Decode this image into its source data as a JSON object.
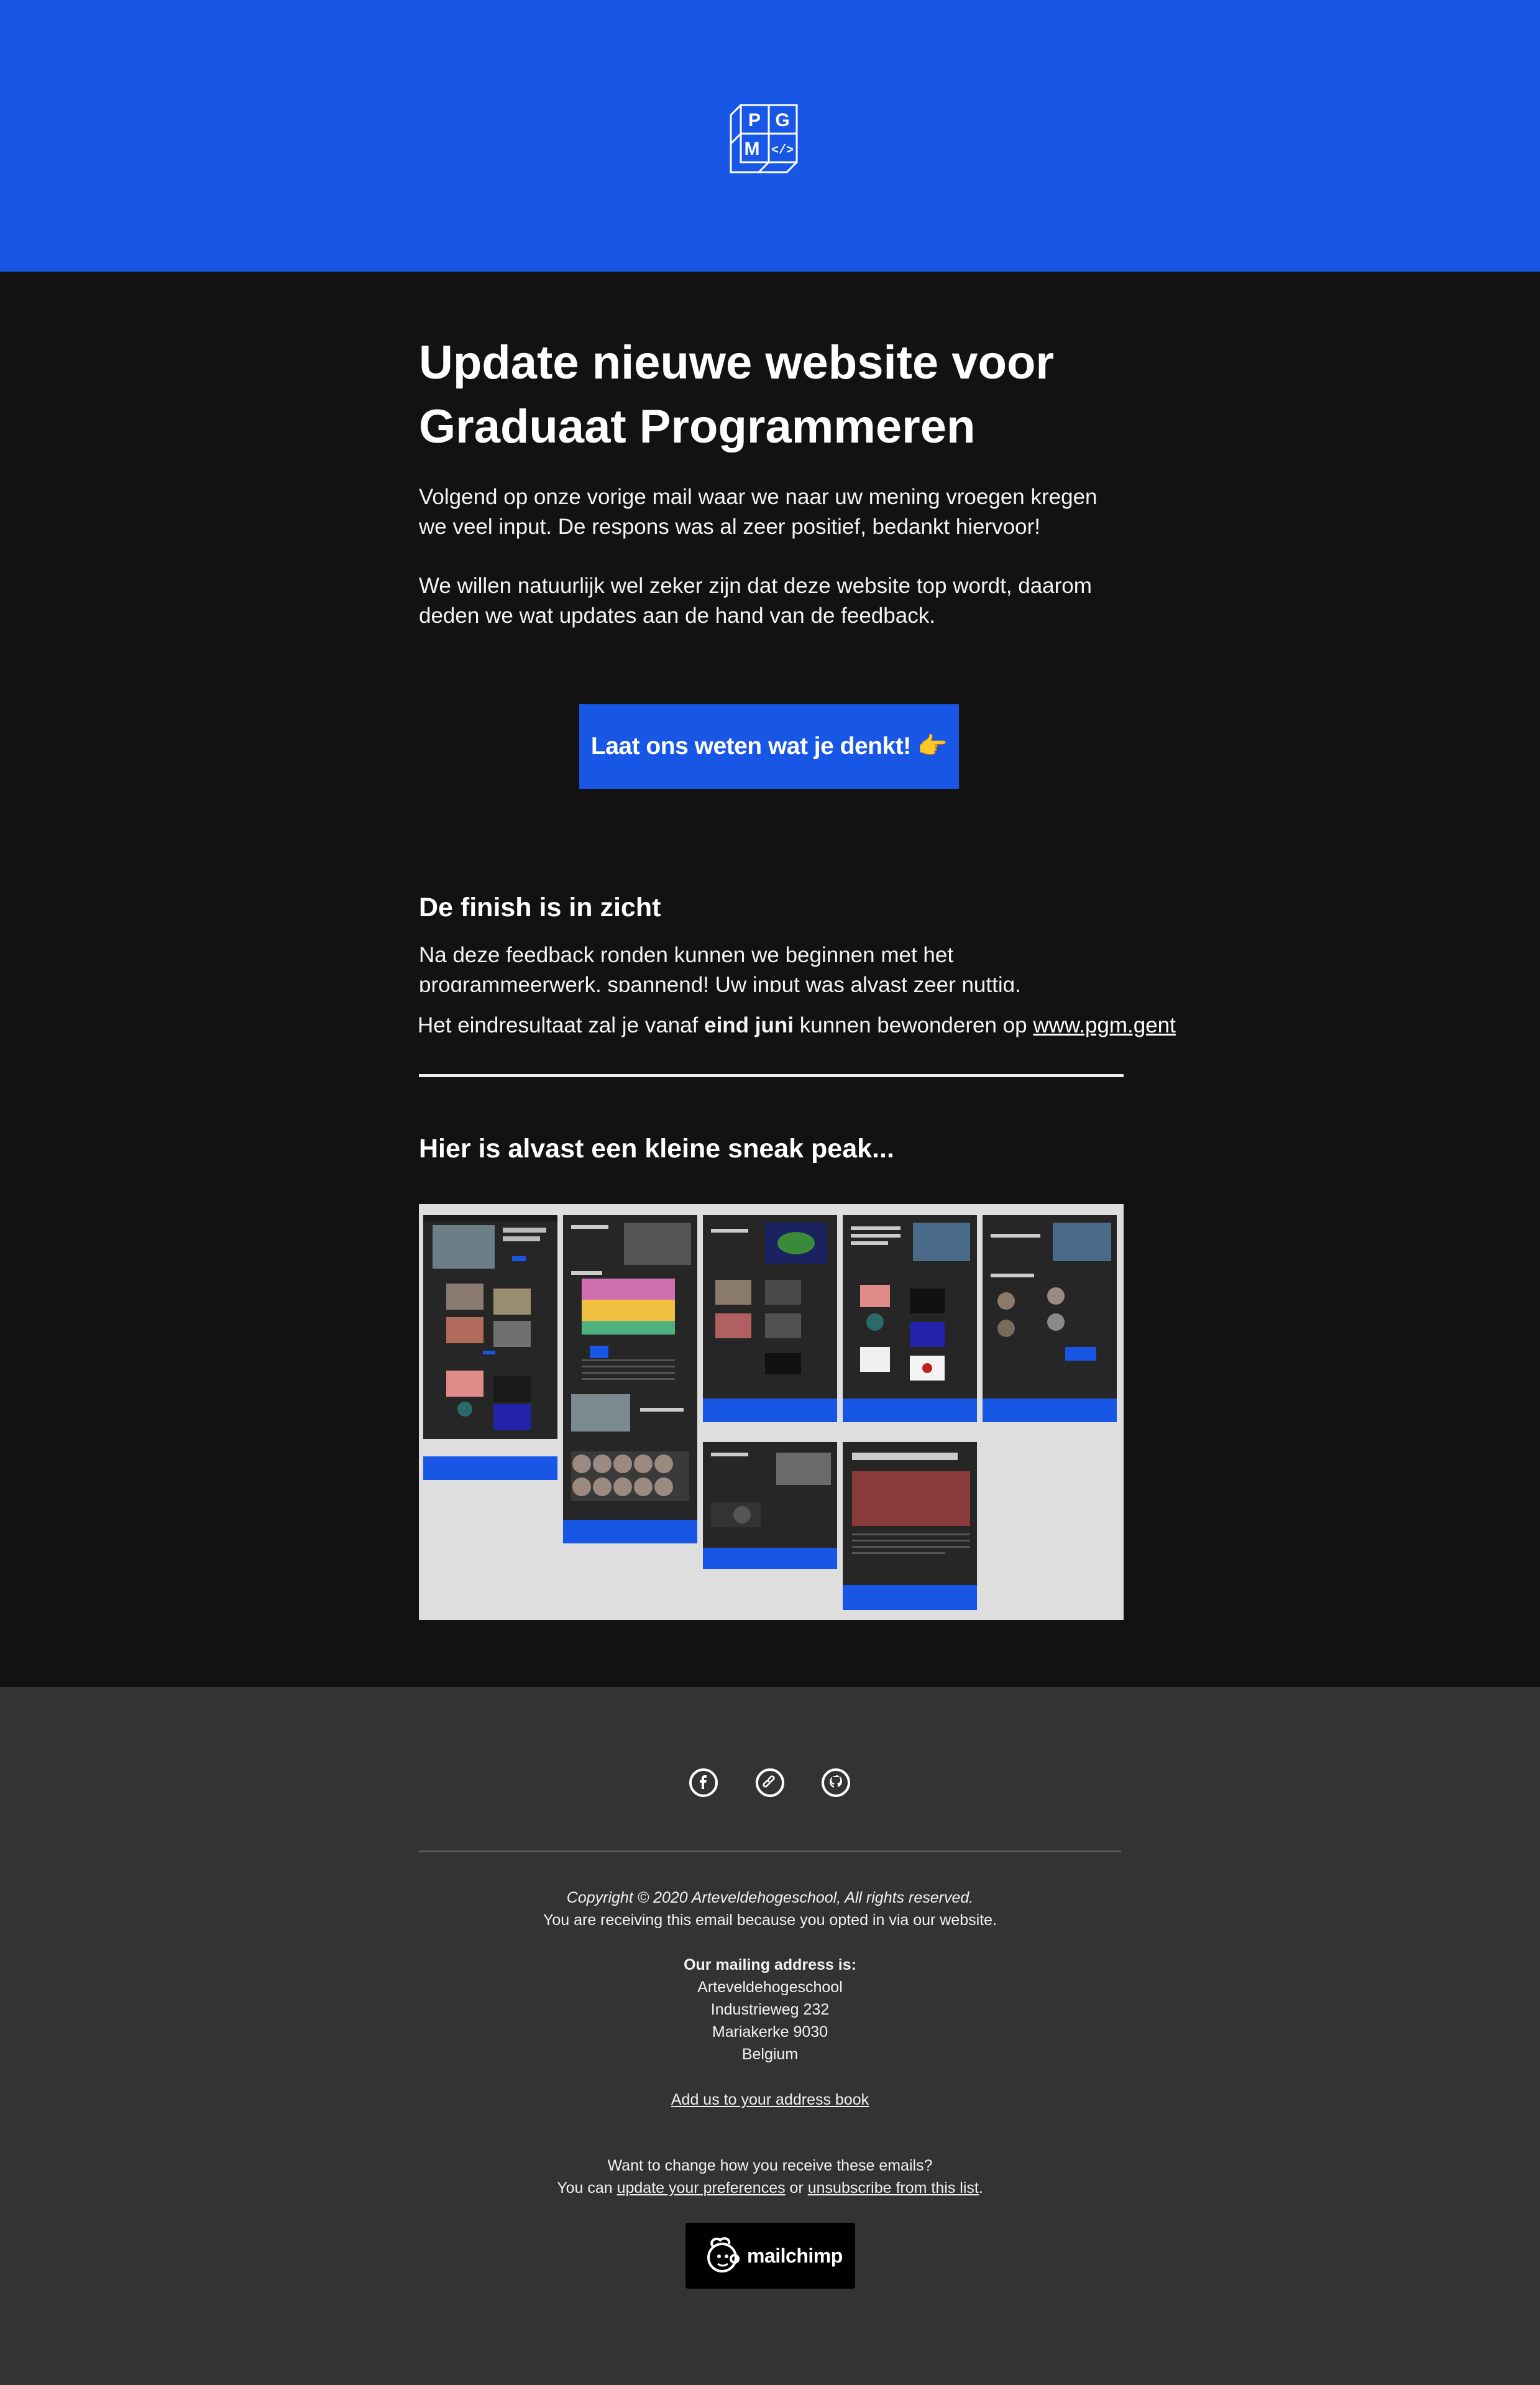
{
  "header": {
    "logo_letters": [
      "P",
      "G",
      "M",
      "</>"
    ],
    "bg_color": "#1856e6"
  },
  "content": {
    "title": "Update nieuwe website voor Graduaat Programmeren",
    "paragraph_1": "Volgend op onze vorige mail waar we naar uw mening vroegen kregen we veel input. De respons was al zeer positief, bedankt hiervoor!",
    "paragraph_2": "We willen natuurlijk wel zeker zijn dat deze website top wordt, daarom deden we wat updates aan de hand van de feedback.",
    "cta_label": "Laat ons weten wat je denkt! 👉",
    "section_title": "De finish is in zicht",
    "section_paragraph": "Na deze feedback ronden kunnen we beginnen met het programmeerwerk, spannend! Uw input was alvast zeer nuttig.",
    "result_prefix": "Het eindresultaat zal je vanaf ",
    "result_bold": "eind juni",
    "result_middle": " kunnen bewonderen op ",
    "result_link": "www.pgm.gent",
    "sneak_title": "Hier is alvast een kleine sneak peak..."
  },
  "footer": {
    "social_icons": [
      "facebook-icon",
      "link-icon",
      "github-icon"
    ],
    "copyright": "Copyright © 2020 Arteveldehogeschool, All rights reserved.",
    "reason": "You are receiving this email because you opted in via our website.",
    "mailing_label": "Our mailing address is:",
    "address_lines": [
      "Arteveldehogeschool",
      "Industrieweg 232",
      "Mariakerke 9030",
      "Belgium"
    ],
    "address_book_link": "Add us to your address book",
    "change_question": "Want to change how you receive these emails?",
    "change_prefix": "You can ",
    "preferences_link": "update your preferences",
    "change_or": " or ",
    "unsubscribe_link": "unsubscribe from this list",
    "change_suffix": ".",
    "badge_label": "mailchimp"
  },
  "colors": {
    "primary": "#1856e6",
    "main_bg": "#121212",
    "footer_bg": "#333333",
    "sneak_bg": "#dedede"
  }
}
